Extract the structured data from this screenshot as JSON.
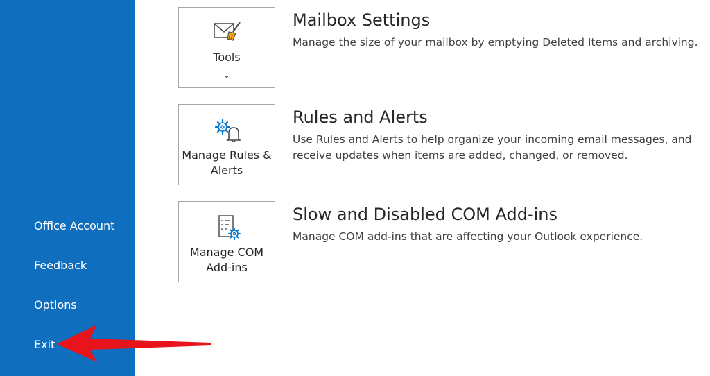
{
  "sidebar": {
    "items": [
      {
        "label": "Office Account"
      },
      {
        "label": "Feedback"
      },
      {
        "label": "Options"
      },
      {
        "label": "Exit"
      }
    ]
  },
  "sections": [
    {
      "tile_label": "Tools",
      "tile_icon": "mailbox-cleanup-icon",
      "tile_dropdown": "⌄",
      "title": "Mailbox Settings",
      "description": "Manage the size of your mailbox by emptying Deleted Items and archiving."
    },
    {
      "tile_label": "Manage Rules & Alerts",
      "tile_icon": "rules-alerts-icon",
      "title": "Rules and Alerts",
      "description": "Use Rules and Alerts to help organize your incoming email messages, and receive updates when items are added, changed, or removed."
    },
    {
      "tile_label": "Manage COM Add-ins",
      "tile_icon": "com-addins-icon",
      "title": "Slow and Disabled COM Add-ins",
      "description": "Manage COM add-ins that are affecting your Outlook experience."
    }
  ],
  "annotation": {
    "icon": "red-arrow-icon",
    "color": "#e8141b"
  },
  "colors": {
    "sidebar_bg": "#106ebe",
    "accent_icon": "#0078d4"
  }
}
